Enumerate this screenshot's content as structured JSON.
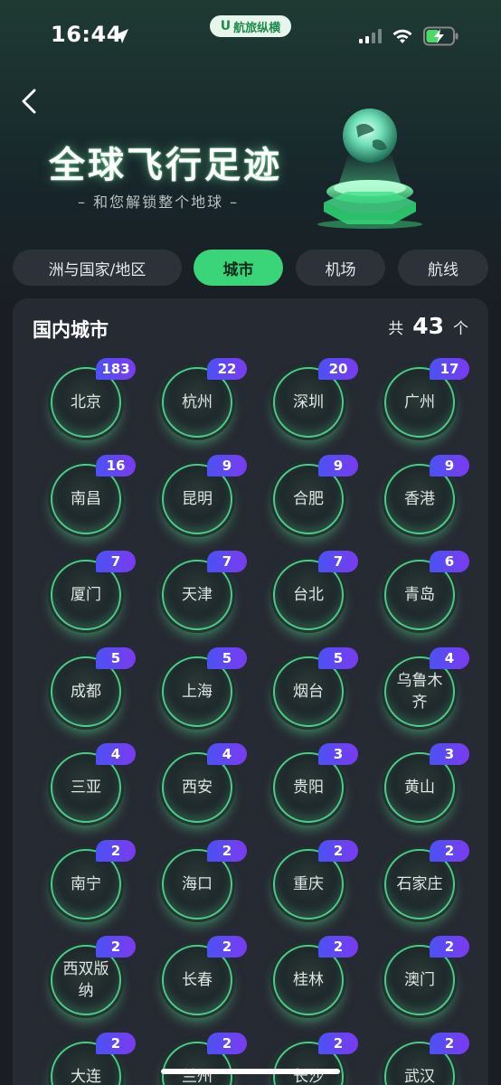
{
  "status_bar": {
    "time": "16:44",
    "app_badge": "航旅纵横",
    "app_badge_logo": "U"
  },
  "header": {
    "title": "全球飞行足迹",
    "subtitle": "– 和您解锁整个地球 –"
  },
  "tabs": [
    {
      "label": "洲与国家/地区",
      "active": false
    },
    {
      "label": "城市",
      "active": true
    },
    {
      "label": "机场",
      "active": false
    },
    {
      "label": "航线",
      "active": false
    }
  ],
  "section": {
    "title": "国内城市",
    "total_prefix": "共",
    "total_count": "43",
    "total_suffix": "个"
  },
  "cities": [
    {
      "name": "北京",
      "count": "183"
    },
    {
      "name": "杭州",
      "count": "22"
    },
    {
      "name": "深圳",
      "count": "20"
    },
    {
      "name": "广州",
      "count": "17"
    },
    {
      "name": "南昌",
      "count": "16"
    },
    {
      "name": "昆明",
      "count": "9"
    },
    {
      "name": "合肥",
      "count": "9"
    },
    {
      "name": "香港",
      "count": "9"
    },
    {
      "name": "厦门",
      "count": "7"
    },
    {
      "name": "天津",
      "count": "7"
    },
    {
      "name": "台北",
      "count": "7"
    },
    {
      "name": "青岛",
      "count": "6"
    },
    {
      "name": "成都",
      "count": "5"
    },
    {
      "name": "上海",
      "count": "5"
    },
    {
      "name": "烟台",
      "count": "5"
    },
    {
      "name": "乌鲁木齐",
      "count": "4"
    },
    {
      "name": "三亚",
      "count": "4"
    },
    {
      "name": "西安",
      "count": "4"
    },
    {
      "name": "贵阳",
      "count": "3"
    },
    {
      "name": "黄山",
      "count": "3"
    },
    {
      "name": "南宁",
      "count": "2"
    },
    {
      "name": "海口",
      "count": "2"
    },
    {
      "name": "重庆",
      "count": "2"
    },
    {
      "name": "石家庄",
      "count": "2"
    },
    {
      "name": "西双版纳",
      "count": "2"
    },
    {
      "name": "长春",
      "count": "2"
    },
    {
      "name": "桂林",
      "count": "2"
    },
    {
      "name": "澳门",
      "count": "2"
    },
    {
      "name": "大连",
      "count": "2"
    },
    {
      "name": "兰州",
      "count": "2"
    },
    {
      "name": "长沙",
      "count": "2"
    },
    {
      "name": "武汉",
      "count": "2"
    }
  ],
  "colors": {
    "accent_green": "#3ad479",
    "badge_gradient_start": "#4b52f5",
    "badge_gradient_end": "#7a3bf0",
    "ring_green": "#4fc98a"
  }
}
